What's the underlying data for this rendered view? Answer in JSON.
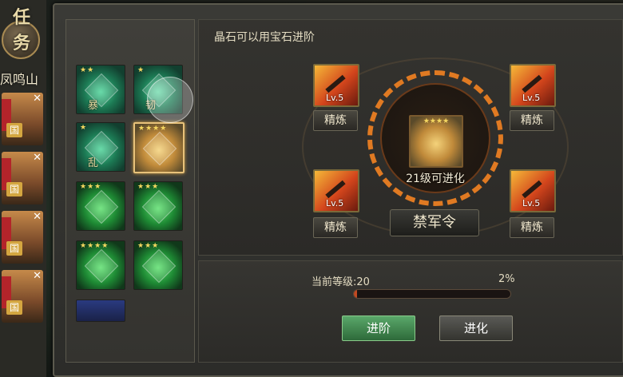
{
  "left_strip": {
    "quest_label": "任务",
    "location": "凤鸣山",
    "heroes": [
      {
        "close": "✕",
        "grade": "国"
      },
      {
        "close": "✕",
        "grade": "国"
      },
      {
        "close": "✕",
        "grade": "国"
      },
      {
        "close": "✕",
        "grade": "国"
      }
    ]
  },
  "gem_list": [
    {
      "stars": "★★",
      "tag": "暴",
      "style": "jade"
    },
    {
      "stars": "★",
      "tag": "韧",
      "style": "jade"
    },
    {
      "stars": "★",
      "tag": "乱",
      "style": "jade"
    },
    {
      "stars": "★★★★",
      "tag": "",
      "style": "gold",
      "selected": true
    },
    {
      "stars": "★★★",
      "tag": "",
      "style": "emer"
    },
    {
      "stars": "★★★",
      "tag": "",
      "style": "emer"
    },
    {
      "stars": "★★★★",
      "tag": "",
      "style": "emer"
    },
    {
      "stars": "★★★",
      "tag": "",
      "style": "emer"
    },
    {
      "stars": "",
      "tag": "",
      "style": "blue"
    }
  ],
  "upgrade": {
    "hint": "晶石可以用宝石进阶",
    "center_stars": "★★★★",
    "evolve_level": "21级可进化",
    "item_name": "禁军令",
    "slots": [
      {
        "level": "Lv.5",
        "refine": "精炼"
      },
      {
        "level": "Lv.5",
        "refine": "精炼"
      },
      {
        "level": "Lv.5",
        "refine": "精炼"
      },
      {
        "level": "Lv.5",
        "refine": "精炼"
      }
    ]
  },
  "progress": {
    "current_level": "当前等级:20",
    "percent_label": "2%",
    "fraction": 0.02
  },
  "buttons": {
    "advance": "进阶",
    "evolve": "进化"
  }
}
